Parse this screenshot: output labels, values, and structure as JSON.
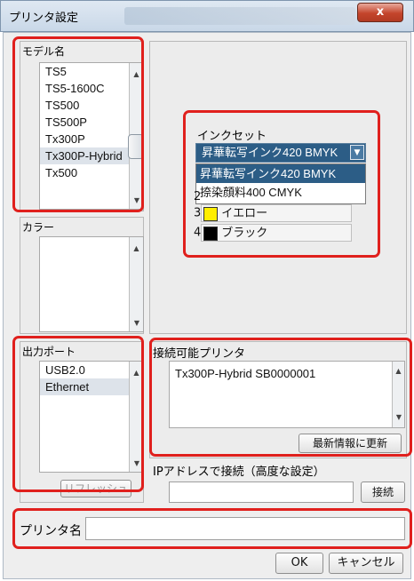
{
  "window": {
    "title": "プリンタ設定",
    "close_label": "x"
  },
  "model": {
    "label": "モデル名",
    "items": [
      "TS5",
      "TS5-1600C",
      "TS500",
      "TS500P",
      "Tx300P",
      "Tx300P-Hybrid",
      "Tx500"
    ],
    "selected_index": 5
  },
  "color": {
    "label": "カラー"
  },
  "ink": {
    "label": "インクセット",
    "selected": "昇華転写インク420 BMYK",
    "options": [
      "昇華転写インク420 BMYK",
      "捺染顔料400 CMYK"
    ],
    "rows": [
      {
        "num": "3",
        "name": "イエロー",
        "swatch_color": "#ffee00"
      },
      {
        "num": "4",
        "name": "ブラック",
        "swatch_color": "#000000"
      }
    ],
    "obscured_row_prefix": "2"
  },
  "port": {
    "label": "出力ポート",
    "items": [
      "USB2.0",
      "Ethernet"
    ],
    "selected_index": 1,
    "hidden_button_label": "リフレッシュ"
  },
  "connectable": {
    "label": "接続可能プリンタ",
    "items": [
      "Tx300P-Hybrid SB0000001"
    ],
    "refresh_button": "最新情報に更新"
  },
  "ip": {
    "label": "IPアドレスで接続（高度な設定）",
    "value": "",
    "connect_button": "接続"
  },
  "printer_name": {
    "label": "プリンタ名",
    "value": ""
  },
  "footer": {
    "ok": "OK",
    "cancel": "キャンセル"
  },
  "colors": {
    "highlight": "#e0201d",
    "selection": "#2c5d86"
  }
}
